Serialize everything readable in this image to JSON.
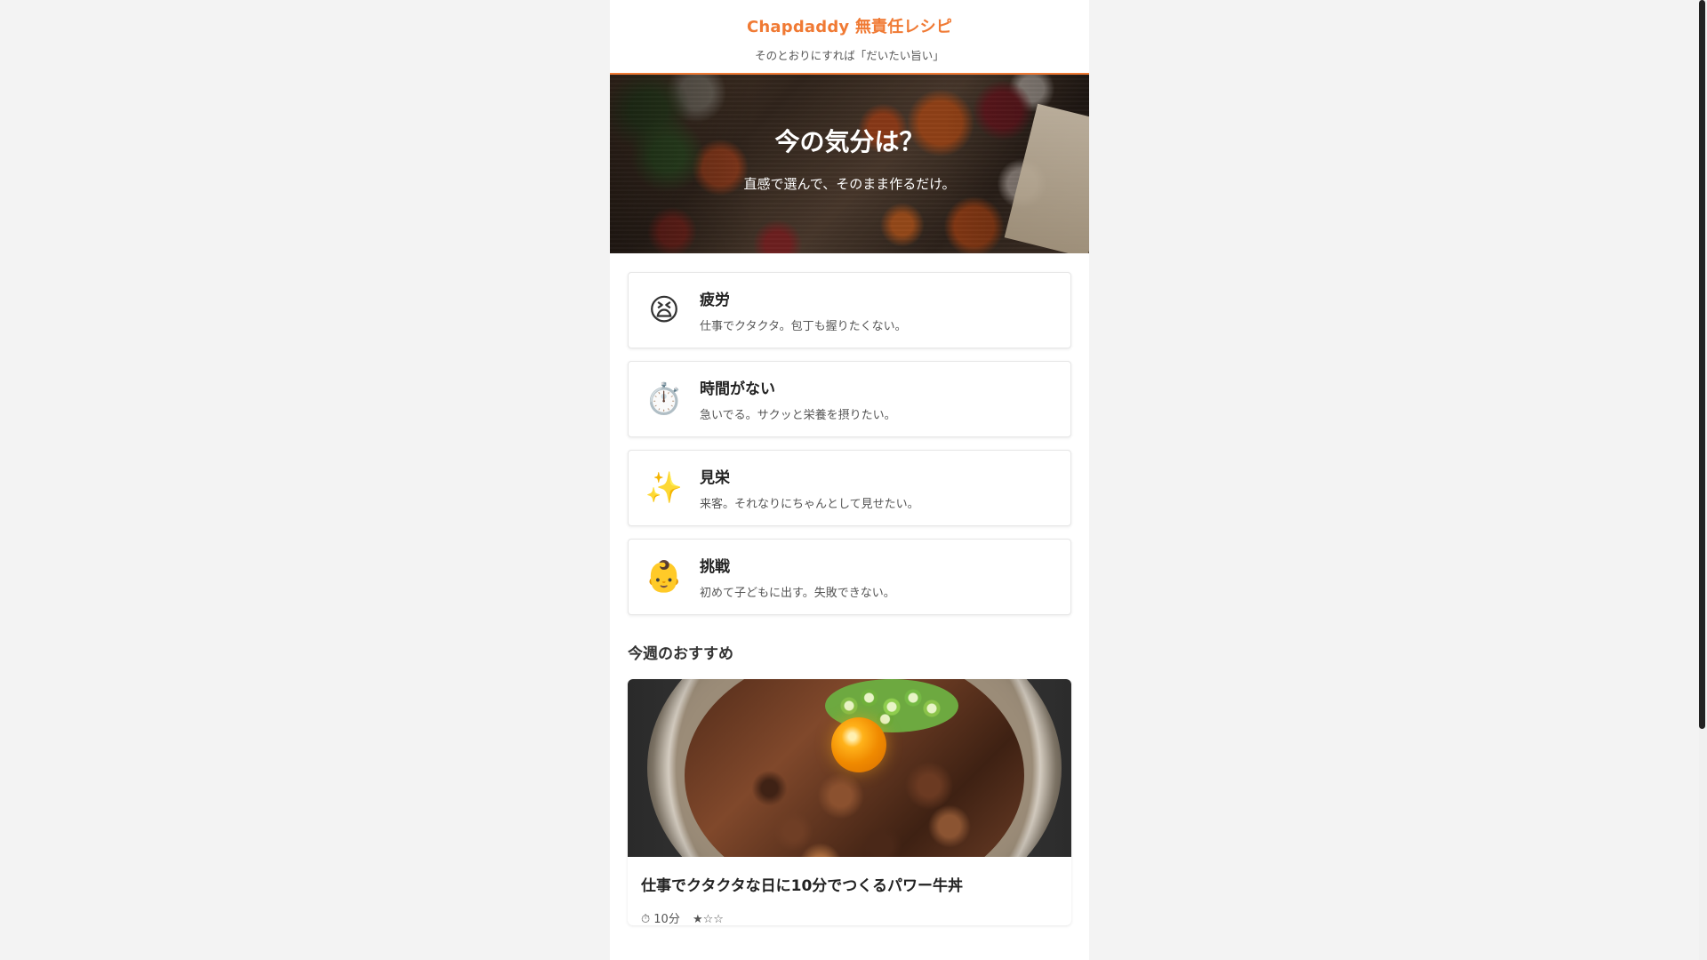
{
  "site": {
    "title": "Chapdaddy 無責任レシピ",
    "tagline": "そのとおりにすれば「だいたい旨い」"
  },
  "hero": {
    "title": "今の気分は？",
    "subtitle": "直感で選んで、そのまま作るだけ。"
  },
  "moods": [
    {
      "icon": "😫",
      "icon_name": "tired-face-icon",
      "title": "疲労",
      "description": "仕事でクタクタ。包丁も握りたくない。"
    },
    {
      "icon": "⏱️",
      "icon_name": "stopwatch-icon",
      "title": "時間がない",
      "description": "急いでる。サクッと栄養を摂りたい。"
    },
    {
      "icon": "✨",
      "icon_name": "sparkles-icon",
      "title": "見栄",
      "description": "来客。それなりにちゃんとして見せたい。"
    },
    {
      "icon": "👶",
      "icon_name": "baby-icon",
      "title": "挑戦",
      "description": "初めて子どもに出す。失敗できない。"
    }
  ],
  "recommendations": {
    "section_title": "今週のおすすめ",
    "featured": {
      "title": "仕事でクタクタな日に10分でつくるパワー牛丼",
      "time": "⏱ 10分",
      "difficulty": "★☆☆",
      "difficulty_rating": 1,
      "difficulty_max": 3
    }
  },
  "colors": {
    "accent": "#f07a34",
    "page_background": "#f3f3f3",
    "card_background": "#ffffff"
  }
}
